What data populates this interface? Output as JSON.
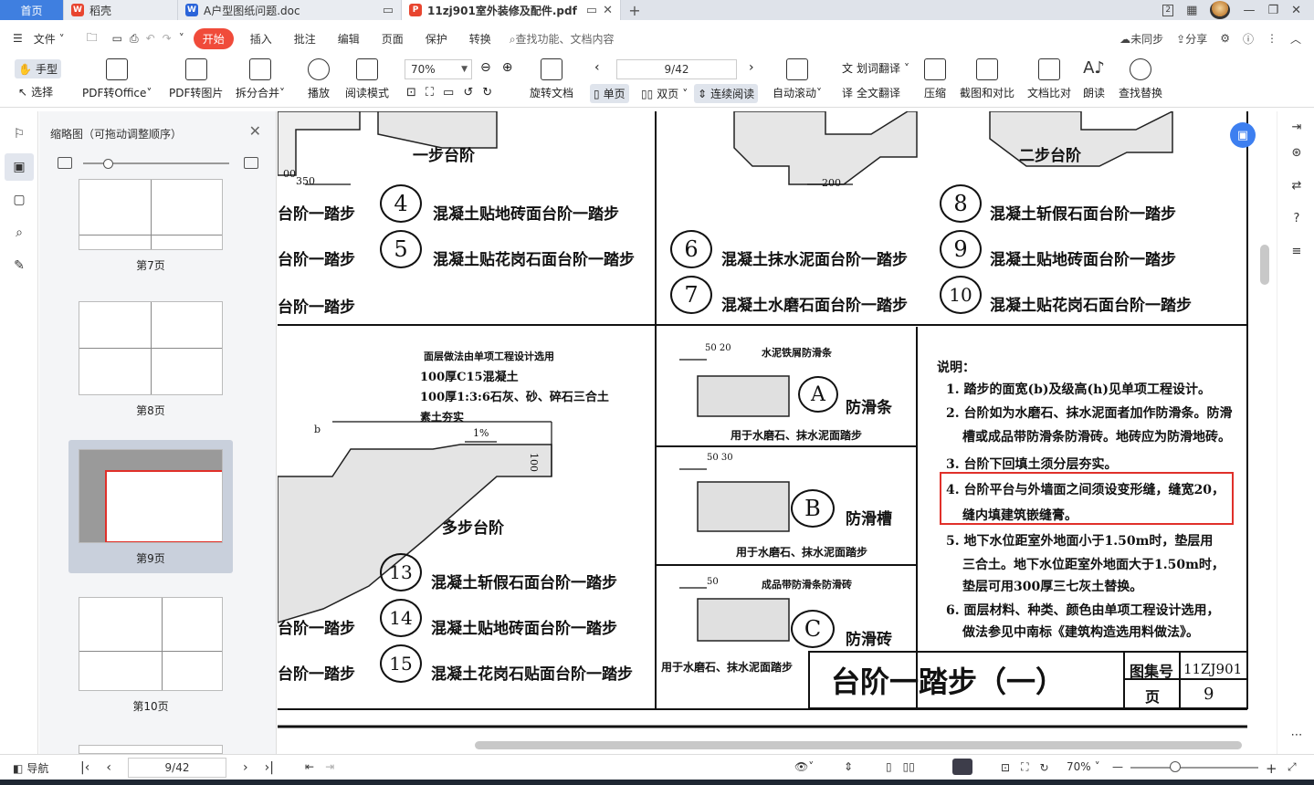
{
  "titlebar": {
    "home": "首页",
    "tabs": [
      {
        "label": "稻壳",
        "icon": "daoke-icon",
        "color": "#e8452f"
      },
      {
        "label": "A户型图纸问题.doc",
        "icon": "word-icon",
        "color": "#2b64d9"
      },
      {
        "label": "11zj901室外装修及配件.pdf",
        "icon": "pdf-icon",
        "color": "#e8452f"
      }
    ],
    "badge": "2"
  },
  "menubar": {
    "file": "文件",
    "items": [
      "开始",
      "插入",
      "批注",
      "编辑",
      "页面",
      "保护",
      "转换"
    ],
    "search": "查找功能、文档内容",
    "sync": "未同步",
    "share": "分享"
  },
  "toolbar": {
    "hand": "手型",
    "select": "选择",
    "pdf_to_office": "PDF转Office",
    "pdf_to_image": "PDF转图片",
    "split_merge": "拆分合并",
    "play": "播放",
    "read_mode": "阅读模式",
    "zoom": "70%",
    "page": "9/42",
    "rotate": "旋转文档",
    "single": "单页",
    "double": "双页",
    "continuous": "连续阅读",
    "auto_scroll": "自动滚动",
    "word_translate": "划词翻译",
    "full_translate": "全文翻译",
    "compress": "压缩",
    "screenshot_compare": "截图和对比",
    "doc_compare": "文档比对",
    "read_aloud": "朗读",
    "find_replace": "查找替换"
  },
  "thumbs": {
    "title": "缩略图（可拖动调整顺序）",
    "pages": [
      "第7页",
      "第8页",
      "第9页",
      "第10页"
    ],
    "current": "第9页"
  },
  "drawing": {
    "one_step": "一步台阶",
    "two_step": "二步台阶",
    "multi_step": "多步台阶",
    "dim_350": "350",
    "dim_200": "200",
    "dim_100": "100",
    "dim_00": "00",
    "left_cut": "台阶一踏步",
    "items_left": [
      {
        "n": "4",
        "t": "混凝土贴地砖面台阶一踏步"
      },
      {
        "n": "5",
        "t": "混凝土贴花岗石面台阶一踏步"
      }
    ],
    "items_mid": [
      {
        "n": "6",
        "t": "混凝土抹水泥面台阶一踏步"
      },
      {
        "n": "7",
        "t": "混凝土水磨石面台阶一踏步"
      }
    ],
    "items_right": [
      {
        "n": "8",
        "t": "混凝土斩假石面台阶一踏步"
      },
      {
        "n": "9",
        "t": "混凝土贴地砖面台阶一踏步"
      },
      {
        "n": "10",
        "t": "混凝土贴花岗石面台阶一踏步"
      }
    ],
    "items_bottom": [
      {
        "n": "13",
        "t": "混凝土斩假石面台阶一踏步"
      },
      {
        "n": "14",
        "t": "混凝土贴地砖面台阶一踏步"
      },
      {
        "n": "15",
        "t": "混凝土花岗石贴面台阶一踏步"
      }
    ],
    "layers_title": "面层做法由单项工程设计选用",
    "layers": [
      "100厚C15混凝土",
      "100厚1:3:6石灰、砂、碎石三合土",
      "素土夯实"
    ],
    "slope": "1%",
    "b": "b",
    "strip_title": "水泥铁屑防滑条",
    "strip_name": "防滑条",
    "strip_letter": "A",
    "strip_use": "用于水磨石、抹水泥面踏步",
    "groove_name": "防滑槽",
    "groove_letter": "B",
    "groove_use": "用于水磨石、抹水泥面踏步",
    "brick_title": "成品带防滑条防滑砖",
    "brick_name": "防滑砖",
    "brick_letter": "C",
    "brick_use": "用于水磨石、抹水泥面踏步",
    "dims_a": "50 20",
    "dims_b": "50 30",
    "dims_c": "50",
    "notes_title": "说明：",
    "notes": [
      "1. 踏步的面宽(b)及级高(h)见单项工程设计。",
      "2. 台阶如为水磨石、抹水泥面者加作防滑条。防滑",
      "槽或成品带防滑条防滑砖。地砖应为防滑地砖。",
      "3. 台阶下回填土须分层夯实。",
      "4. 台阶平台与外墙面之间须设变形缝，缝宽20，",
      "缝内填建筑嵌缝膏。",
      "5. 地下水位距室外地面小于1.50m时，垫层用",
      "三合土。地下水位距室外地面大于1.50m时，",
      "垫层可用300厚三七灰土替换。",
      "6. 面层材料、种类、颜色由单项工程设计选用，",
      "做法参见中南标《建筑构造选用料做法》。"
    ],
    "title_block": "台阶一踏步（一）",
    "atlas_label": "图集号",
    "atlas_no": "11ZJ901",
    "page_label": "页",
    "page_no": "9"
  },
  "status": {
    "nav": "导航",
    "page": "9/42",
    "zoom": "70%"
  },
  "colors": {
    "accent": "#3f7fe0",
    "highlight": "#e0302a",
    "start_button": "#f04b3a"
  }
}
